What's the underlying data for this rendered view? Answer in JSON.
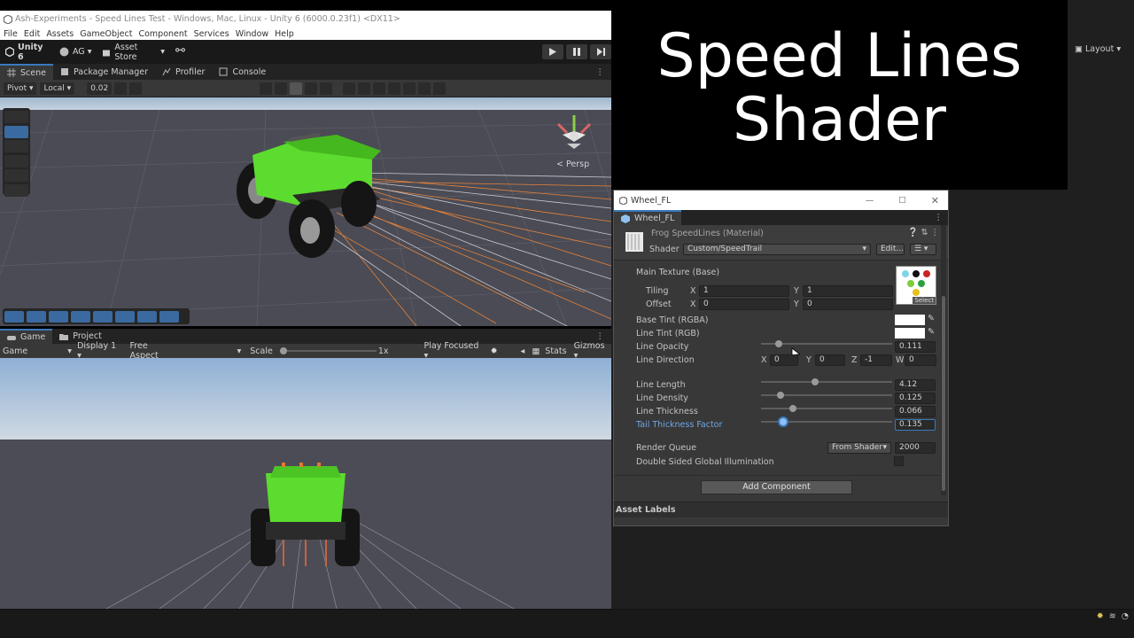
{
  "window": {
    "title": "Ash-Experiments - Speed Lines Test - Windows, Mac, Linux - Unity 6 (6000.0.23f1) <DX11>"
  },
  "menu": [
    "File",
    "Edit",
    "Assets",
    "GameObject",
    "Component",
    "Services",
    "Window",
    "Help"
  ],
  "toolbar": {
    "unity_label": "Unity 6",
    "account": "AG",
    "asset_store": "Asset Store",
    "layout": "Layout"
  },
  "scene_tabs": [
    "Scene",
    "Package Manager",
    "Profiler",
    "Console"
  ],
  "scene_toolbar": {
    "pivot": "Pivot",
    "local": "Local",
    "snap_value": "0.02"
  },
  "scene": {
    "persp_label": "< Persp"
  },
  "game_tabs": [
    "Game",
    "Project"
  ],
  "game_bar": {
    "view": "Game",
    "display": "Display 1",
    "aspect": "Free Aspect",
    "scale_label": "Scale",
    "scale_value": "1x",
    "play_focused": "Play Focused",
    "stats": "Stats",
    "gizmos": "Gizmos"
  },
  "banner": {
    "line1": "Speed Lines",
    "line2": "Shader"
  },
  "inspector": {
    "window_title": "Wheel_FL",
    "tab_label": "Wheel_FL",
    "material_name": "Frog SpeedLines (Material)",
    "shader_label": "Shader",
    "shader_value": "Custom/SpeedTrail",
    "edit_button": "Edit...",
    "main_texture_label": "Main Texture (Base)",
    "tiling_label": "Tiling",
    "offset_label": "Offset",
    "tiling_x": "1",
    "tiling_y": "1",
    "offset_x": "0",
    "offset_y": "0",
    "axis_x": "X",
    "axis_y": "Y",
    "axis_z": "Z",
    "axis_w": "W",
    "select_label": "Select",
    "base_tint_label": "Base Tint (RGBA)",
    "line_tint_label": "Line Tint (RGB)",
    "line_opacity_label": "Line Opacity",
    "line_opacity_value": "0.111",
    "line_opacity_fraction": 0.111,
    "line_direction_label": "Line Direction",
    "dir_x": "0",
    "dir_y": "0",
    "dir_z": "-1",
    "dir_w": "0",
    "line_length_label": "Line Length",
    "line_length_value": "4.12",
    "line_length_fraction": 0.41,
    "line_density_label": "Line Density",
    "line_density_value": "0.125",
    "line_density_fraction": 0.13,
    "line_thickness_label": "Line Thickness",
    "line_thickness_value": "0.066",
    "line_thickness_fraction": 0.23,
    "tail_label": "Tail Thickness Factor",
    "tail_value": "0.135",
    "tail_fraction": 0.15,
    "render_queue_label": "Render Queue",
    "render_queue_mode": "From Shader",
    "render_queue_value": "2000",
    "double_sided_label": "Double Sided Global Illumination",
    "add_component": "Add Component",
    "asset_labels": "Asset Labels"
  },
  "colors": {
    "accent": "#3a79bb",
    "car_green": "#5cdc2e",
    "sky": "#b6c9de",
    "ground": "#4a4b54"
  }
}
